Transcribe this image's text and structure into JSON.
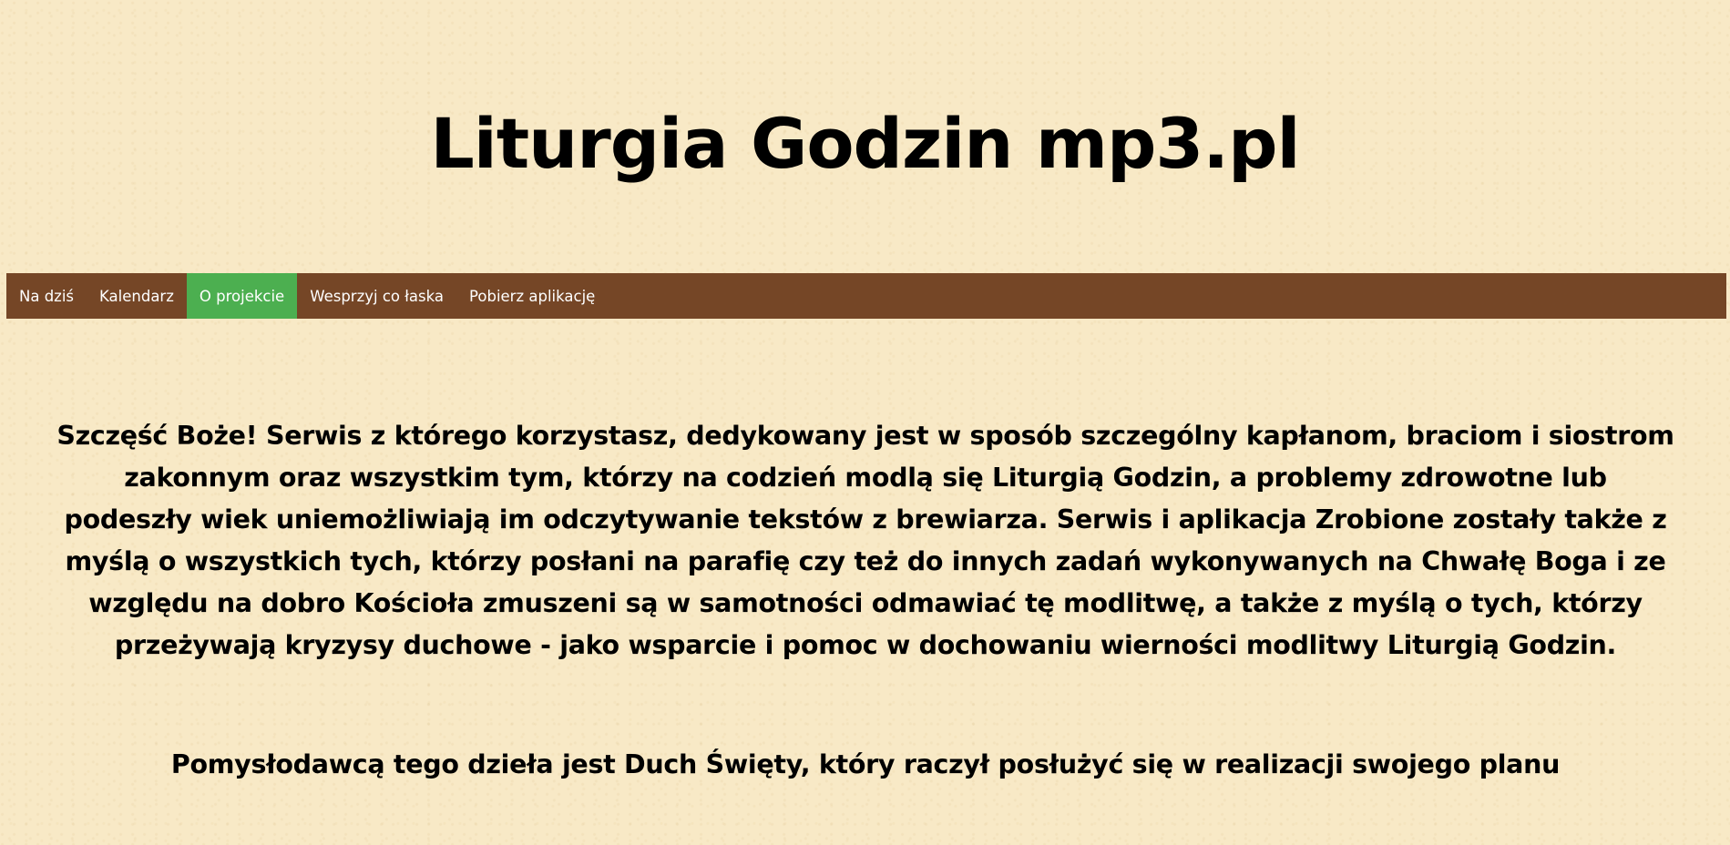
{
  "header": {
    "title": "Liturgia Godzin mp3.pl"
  },
  "nav": {
    "items": [
      {
        "label": "Na dziś",
        "active": false
      },
      {
        "label": "Kalendarz",
        "active": false
      },
      {
        "label": "O projekcie",
        "active": true
      },
      {
        "label": "Wesprzyj co łaska",
        "active": false
      },
      {
        "label": "Pobierz aplikację",
        "active": false
      }
    ],
    "background_color": "#754626",
    "active_color": "#4caf50"
  },
  "content": {
    "paragraph1": "Szczęść Boże! Serwis z którego korzystasz, dedykowany jest w sposób szczególny kapłanom, braciom i siostrom zakonnym oraz wszystkim tym, którzy na codzień modlą się Liturgią Godzin, a problemy zdrowotne lub podeszły wiek uniemożliwiają im odczytywanie tekstów z brewiarza. Serwis i aplikacja Zrobione zostały także z myślą o wszystkich tych, którzy posłani na parafię czy też do innych zadań wykonywanych na Chwałę Boga i ze względu na dobro Kościoła zmuszeni są w samotności odmawiać tę modlitwę, a także z myślą o tych, którzy przeżywają kryzysy duchowe - jako wsparcie i pomoc w dochowaniu wierności modlitwy Liturgią Godzin.",
    "paragraph2": "Pomysłodawcą tego dzieła jest Duch Święty, który raczył posłużyć się w realizacji swojego planu"
  },
  "page_background_color": "#f8e9c6"
}
